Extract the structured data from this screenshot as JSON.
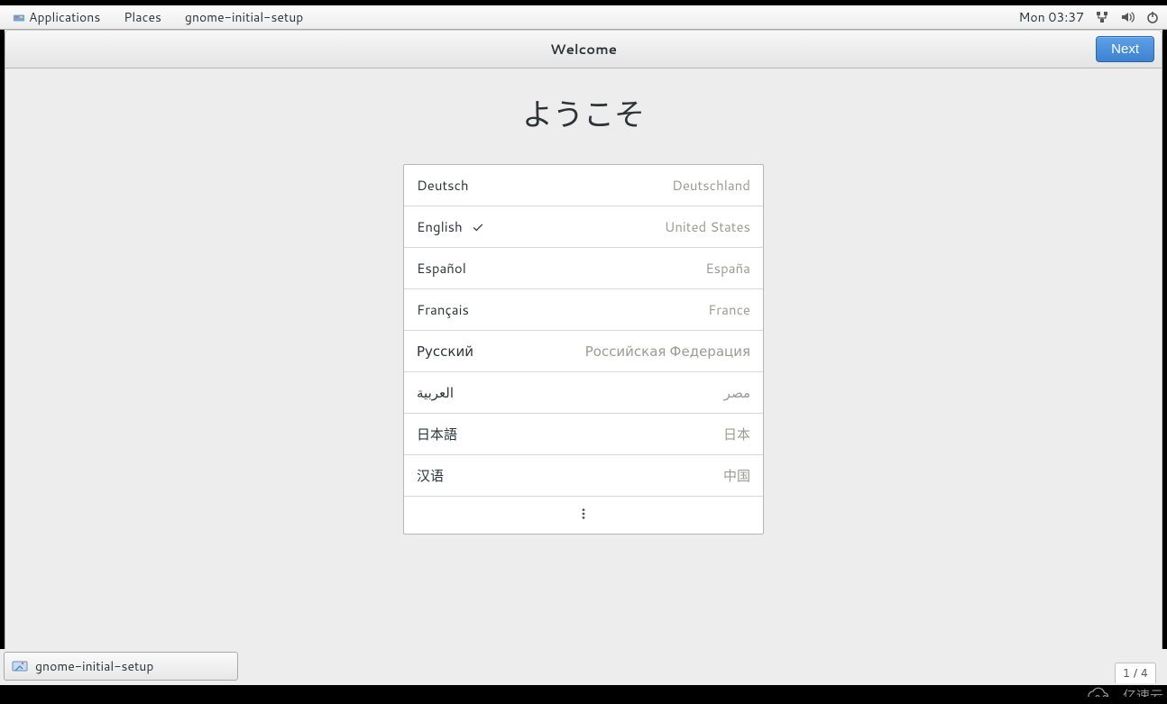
{
  "top_panel": {
    "applications": "Applications",
    "places": "Places",
    "active_app": "gnome-initial-setup",
    "clock": "Mon 03:37"
  },
  "header": {
    "title": "Welcome",
    "next": "Next"
  },
  "main": {
    "heading": "ようこそ"
  },
  "languages": [
    {
      "name": "Deutsch",
      "country": "Deutschland",
      "selected": false
    },
    {
      "name": "English",
      "country": "United States",
      "selected": true
    },
    {
      "name": "Español",
      "country": "España",
      "selected": false
    },
    {
      "name": "Français",
      "country": "France",
      "selected": false
    },
    {
      "name": "Русский",
      "country": "Российская Федерация",
      "selected": false
    },
    {
      "name": "العربية",
      "country": "مصر",
      "selected": false
    },
    {
      "name": "日本語",
      "country": "日本",
      "selected": false
    },
    {
      "name": "汉语",
      "country": "中国",
      "selected": false
    }
  ],
  "taskbar": {
    "window_title": "gnome-initial-setup",
    "page_counter": "1 / 4"
  },
  "watermark": "亿速云"
}
